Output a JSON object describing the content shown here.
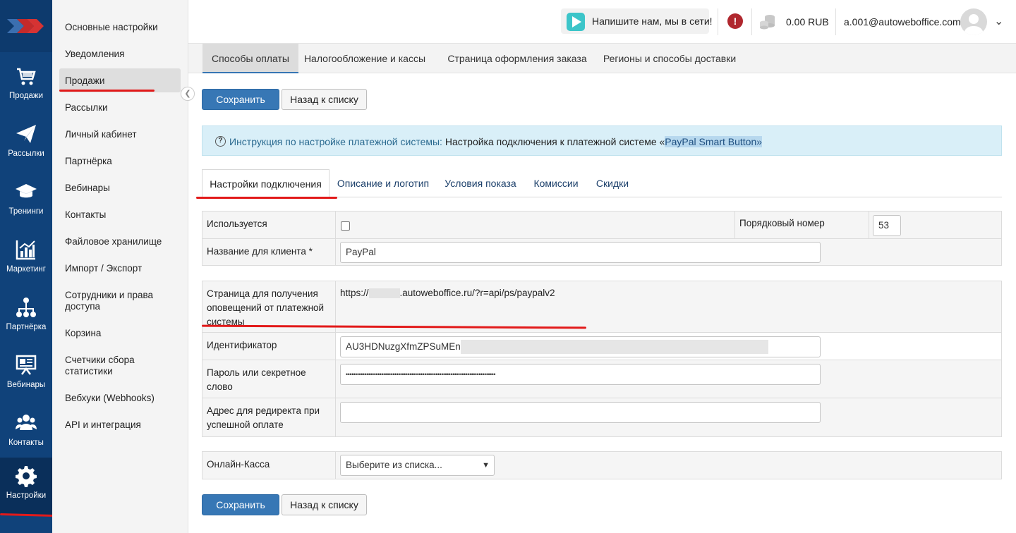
{
  "rail": {
    "items": [
      {
        "label": "Продажи",
        "icon": "cart-icon"
      },
      {
        "label": "Рассылки",
        "icon": "paper-plane-icon"
      },
      {
        "label": "Тренинги",
        "icon": "graduation-cap-icon"
      },
      {
        "label": "Маркетинг",
        "icon": "bar-chart-icon"
      },
      {
        "label": "Партнёрка",
        "icon": "network-icon"
      },
      {
        "label": "Вебинары",
        "icon": "presentation-icon"
      },
      {
        "label": "Контакты",
        "icon": "users-icon"
      },
      {
        "label": "Настройки",
        "icon": "gear-icon"
      }
    ],
    "active": "Настройки"
  },
  "submenu": {
    "items": [
      "Основные настройки",
      "Уведомления",
      "Продажи",
      "Рассылки",
      "Личный кабинет",
      "Партнёрка",
      "Вебинары",
      "Контакты",
      "Файловое хранилище",
      "Импорт / Экспорт",
      "Сотрудники и права доступа",
      "Корзина",
      "Счетчики сбора статистики",
      "Вебхуки (Webhooks)",
      "API и интеграция"
    ],
    "active": "Продажи"
  },
  "topbar": {
    "chat_label": "Напишите нам, мы в сети!",
    "balance": "0.00 RUB",
    "email": "a.001@autoweboffice.com"
  },
  "tabs": [
    "Способы оплаты",
    "Налогообложение и кассы",
    "Страница оформления заказа",
    "Регионы и способы доставки"
  ],
  "buttons": {
    "save": "Сохранить",
    "back": "Назад к списку"
  },
  "info": {
    "lead": "Инструкция по настройке платежной системы:",
    "text": "Настройка подключения к платежной системе «",
    "highlight": "PayPal Smart Button",
    "tail": "»"
  },
  "subtabs": [
    "Настройки подключения",
    "Описание и логотип",
    "Условия показа",
    "Комиссии",
    "Скидки"
  ],
  "form": {
    "used_label": "Используется",
    "order_label": "Порядковый номер",
    "order_value": "53",
    "client_name_label": "Название для клиента *",
    "client_name_value": "PayPal",
    "notify_label": "Страница для получения оповещений от платежной системы",
    "notify_url_prefix": "https://",
    "notify_url_suffix": ".autoweboffice.ru/?r=api/ps/paypalv2",
    "identifier_label": "Идентификатор",
    "identifier_value": "AU3HDNuzgXfmZPSuMEnU",
    "password_label": "Пароль или секретное слово",
    "password_value": "••••••••••••••••••••••••••••••••••••••••••••••••••••••••••••••••••••••••••••••••",
    "redirect_label": "Адрес для редиректа при успешной оплате",
    "redirect_value": "",
    "cashbox_label": "Онлайн-Касса",
    "cashbox_value": "Выберите из списка..."
  }
}
